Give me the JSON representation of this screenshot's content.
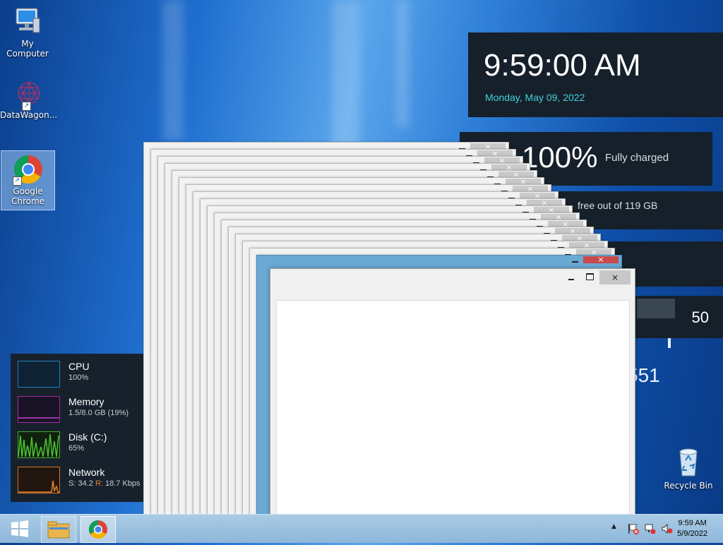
{
  "desktop": {
    "icons": [
      {
        "label": "My Computer",
        "icon": "computer-icon"
      },
      {
        "label": "DataWagon...",
        "icon": "datawagon-icon"
      },
      {
        "label": "Google Chrome",
        "icon": "chrome-icon"
      }
    ],
    "recycle_bin": {
      "label": "Recycle Bin",
      "icon": "recycle-bin-icon"
    }
  },
  "gadgets": {
    "clock": {
      "time": "9:59:00 AM",
      "date": "Monday, May 09, 2022",
      "date_color": "#3fd1dc"
    },
    "battery": {
      "percent": "100%",
      "status": "Fully charged"
    },
    "disk": {
      "text": "free out of 119 GB"
    },
    "counter": {
      "value": "50"
    },
    "partial_number": "551"
  },
  "resource_monitor": {
    "cpu": {
      "label": "CPU",
      "value": "100%",
      "color": "#1e7fc0"
    },
    "memory": {
      "label": "Memory",
      "value": "1.5/8.0 GB (19%)",
      "color": "#a12aa8"
    },
    "disk": {
      "label": "Disk (C:)",
      "value": "65%",
      "color": "#3fae2a"
    },
    "network": {
      "label": "Network",
      "send_label": "S:",
      "send_value": "34.2",
      "recv_label": "R:",
      "recv_value": "18.7 Kbps",
      "color": "#d9701f"
    }
  },
  "window": {
    "close_glyph": "×"
  },
  "taskbar": {
    "start": "start-icon",
    "pinned": [
      "file-explorer-icon",
      "chrome-icon"
    ],
    "tray": {
      "time": "9:59 AM",
      "date": "5/9/2022"
    }
  }
}
